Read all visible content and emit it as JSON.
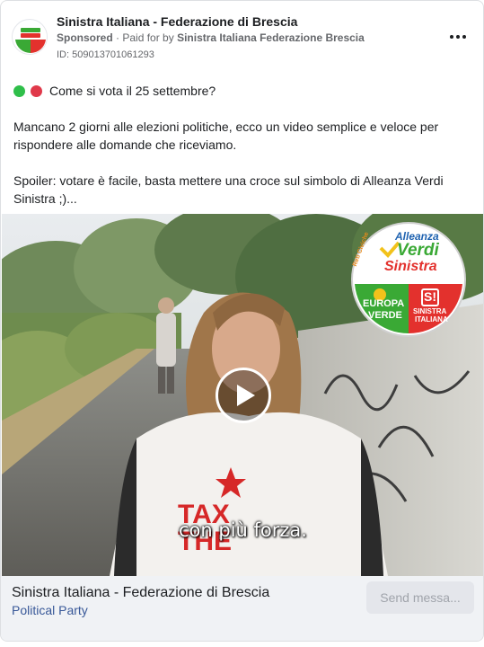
{
  "header": {
    "page_name": "Sinistra Italiana - Federazione di Brescia",
    "sponsored_label": "Sponsored",
    "paid_for_prefix": "· Paid for by",
    "paid_for_by": "Sinistra Italiana Federazione Brescia",
    "ad_id": "ID: 509013701061293",
    "more_icon": "more-horizontal-icon"
  },
  "post": {
    "line1": "Come si vota il 25 settembre?",
    "dot_colors": [
      "#2fbf4a",
      "#e0394a"
    ],
    "line2": "Mancano 2 giorni alle elezioni politiche, ecco un video semplice e veloce per rispondere alle domande che riceviamo.",
    "line3": "Spoiler: votare è facile, basta mettere una croce sul simbolo di Alleanza Verdi Sinistra ;)..."
  },
  "video": {
    "subtitle": "con più forza.",
    "shirt_text_1": "TAX",
    "shirt_text_2": "THE",
    "play_icon": "play-icon",
    "badge": {
      "top_line": "Alleanza",
      "middle_line": "Verdi",
      "bottom_line": "Sinistra",
      "side_text": "Reti Civiche",
      "left_label_1": "EUROPA",
      "left_label_2": "VERDE",
      "right_logo": "S!",
      "right_label_1": "SINISTRA",
      "right_label_2": "ITALIANA"
    }
  },
  "footer": {
    "page_name": "Sinistra Italiana - Federazione di Brescia",
    "category": "Political Party",
    "send_button": "Send messa..."
  },
  "colors": {
    "link_blue": "#385898",
    "verdi_green": "#3aa935",
    "sinistra_red": "#e3312d"
  }
}
